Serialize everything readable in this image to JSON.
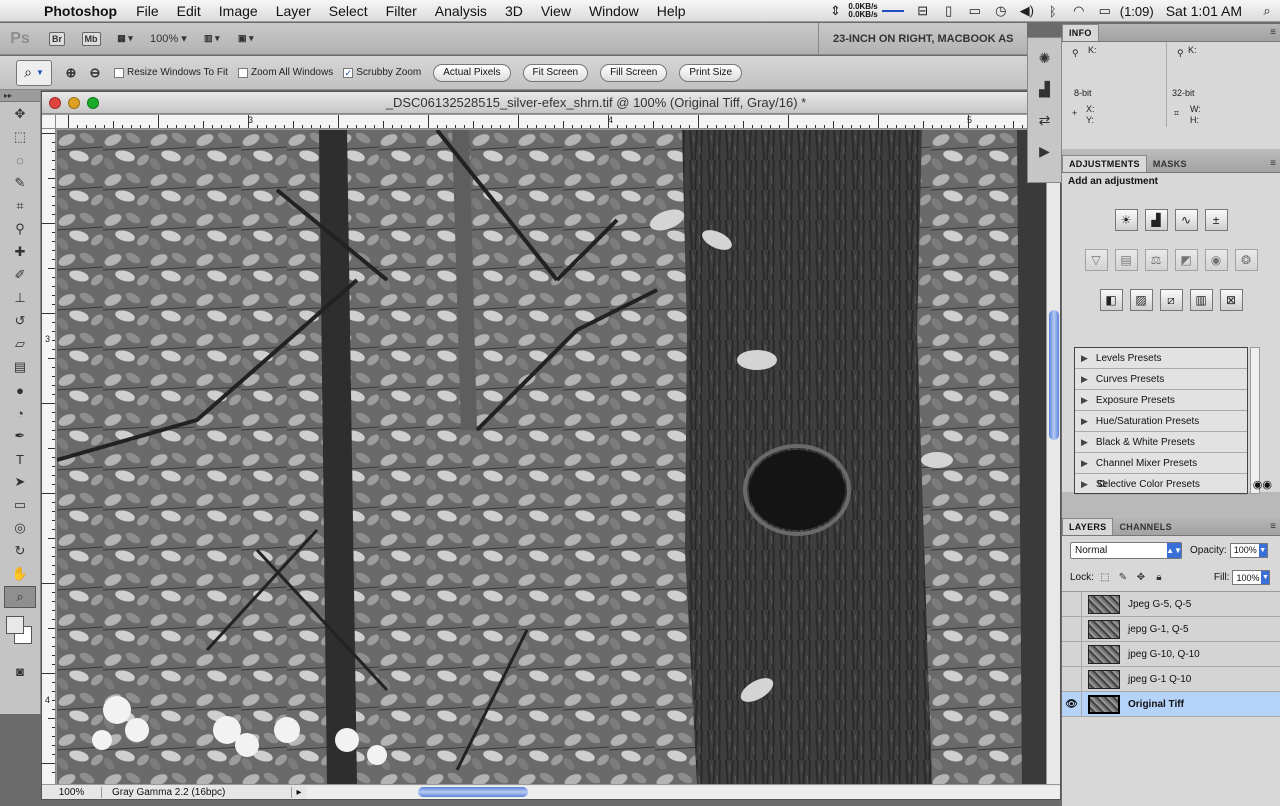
{
  "menubar": {
    "app_name": "Photoshop",
    "items": [
      "File",
      "Edit",
      "Image",
      "Layer",
      "Select",
      "Filter",
      "Analysis",
      "3D",
      "View",
      "Window",
      "Help"
    ],
    "net_up": "0.0KB/s",
    "net_down": "0.0KB/s",
    "battery": "(1:09)",
    "clock": "Sat 1:01 AM"
  },
  "appbar": {
    "logo": "Ps",
    "bridge_label": "Br",
    "minibridge_label": "Mb",
    "zoom": "100%",
    "workspace": "23-INCH ON RIGHT, MACBOOK AS"
  },
  "options": {
    "resize_windows": "Resize Windows To Fit",
    "zoom_all": "Zoom All Windows",
    "scrubby": "Scrubby Zoom",
    "actual_pixels": "Actual Pixels",
    "fit_screen": "Fit Screen",
    "fill_screen": "Fill Screen",
    "print_size": "Print Size"
  },
  "document": {
    "title": "_DSC06132528515_silver-efex_shrn.tif @ 100% (Original Tiff, Gray/16) *",
    "ruler_h": [
      "3",
      "4",
      "5"
    ],
    "ruler_v": [
      "3",
      "4"
    ],
    "status_zoom": "100%",
    "status_info": "Gray Gamma 2.2 (16bpc)"
  },
  "info_panel": {
    "tab": "INFO",
    "k1": "K:",
    "k2": "K:",
    "bit1": "8-bit",
    "bit2": "32-bit",
    "x": "X:",
    "y": "Y:",
    "w": "W:",
    "h": "H:"
  },
  "adjustments_panel": {
    "tab_adjustments": "ADJUSTMENTS",
    "tab_masks": "MASKS",
    "title": "Add an adjustment",
    "presets": [
      "Levels Presets",
      "Curves Presets",
      "Exposure Presets",
      "Hue/Saturation Presets",
      "Black & White Presets",
      "Channel Mixer Presets",
      "Selective Color Presets"
    ]
  },
  "layers_panel": {
    "tab_layers": "LAYERS",
    "tab_channels": "CHANNELS",
    "blend_mode": "Normal",
    "opacity_label": "Opacity:",
    "opacity": "100%",
    "lock_label": "Lock:",
    "fill_label": "Fill:",
    "fill": "100%",
    "layers": [
      {
        "name": "Jpeg G-5, Q-5",
        "visible": false,
        "selected": false
      },
      {
        "name": "jepg G-1, Q-5",
        "visible": false,
        "selected": false
      },
      {
        "name": "jpeg G-10, Q-10",
        "visible": false,
        "selected": false
      },
      {
        "name": "jpeg G-1 Q-10",
        "visible": false,
        "selected": false
      },
      {
        "name": "Original Tiff",
        "visible": true,
        "selected": true
      }
    ]
  },
  "colors": {
    "selection_blue": "#b5d2f8",
    "accent_blue": "#3a6fd8"
  }
}
